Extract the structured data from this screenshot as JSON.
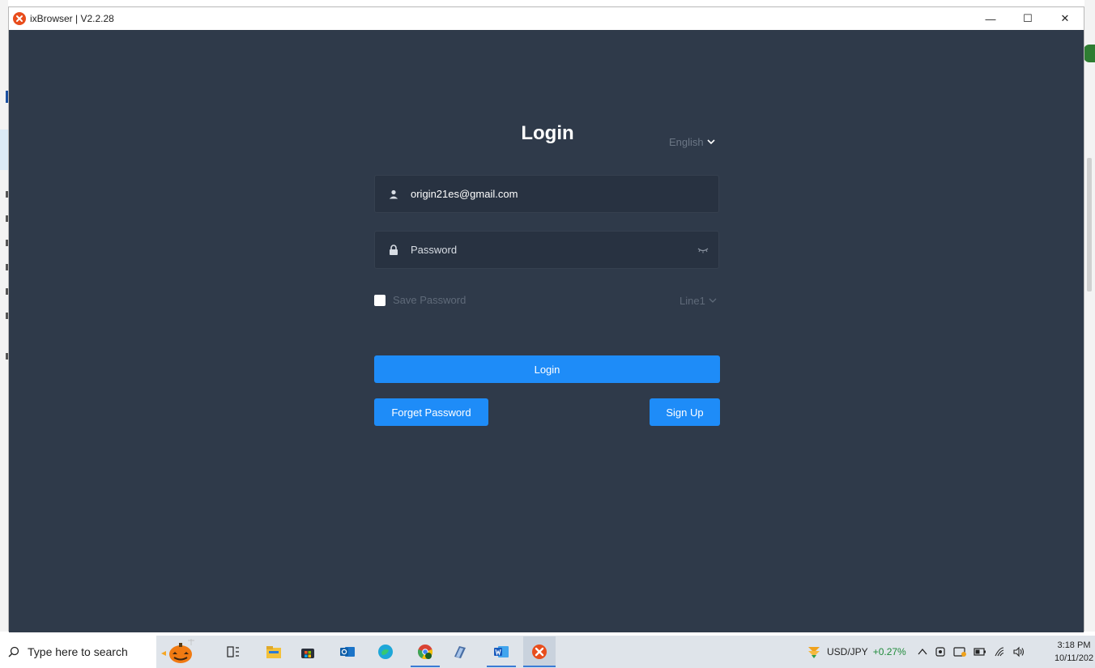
{
  "window": {
    "title": "ixBrowser | V2.2.28",
    "minimize": "—",
    "maximize": "☐",
    "close": "✕"
  },
  "login": {
    "heading": "Login",
    "language": "English",
    "email_value": "origin21es@gmail.com",
    "password_placeholder": "Password",
    "save_password_label": "Save Password",
    "line_select": "Line1",
    "login_button": "Login",
    "forget_button": "Forget Password",
    "signup_button": "Sign Up"
  },
  "taskbar": {
    "search_placeholder": "Type here to search",
    "ticker_symbol": "USD/JPY",
    "ticker_change": "+0.27%",
    "time": "3:18 PM",
    "date": "10/11/202"
  },
  "colors": {
    "background": "#2f3a4a",
    "input_bg": "#283241",
    "accent": "#1e8cf8"
  }
}
